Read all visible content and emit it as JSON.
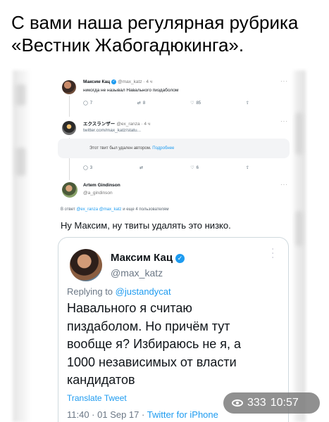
{
  "post": {
    "caption_line1": "С вами наша регулярная рубрика",
    "caption_line2": "«Вестник Жабогадюкинга».",
    "views": "333",
    "time": "10:57"
  },
  "tweet1": {
    "name": "Максим Кац",
    "handle": "@max_katz · 4 ч",
    "text": "никогда не называл Навального пиздаболом",
    "replies": "7",
    "retweets": "8",
    "likes": "85"
  },
  "tweet2": {
    "name": "エクスランザー",
    "handle": "@ex_ranza · 4 ч",
    "link": "twitter.com/max_katz/statu...",
    "deleted_text": "Этот твит был удален автором.",
    "deleted_more": "Подробнее",
    "replies": "3",
    "likes": "6"
  },
  "tweet3": {
    "name": "Artem Gindinson",
    "handle": "@a_gindinson",
    "reply_prefix": "В ответ",
    "reply_mentions": "@ex_ranza @max_katz",
    "reply_suffix": "и еще 4 пользователям",
    "text": "Ну Максим, ну твиты удалять это низко."
  },
  "quoted": {
    "name": "Максим Кац",
    "handle": "@max_katz",
    "replying_prefix": "Replying to",
    "replying_mention": "@justandycat",
    "lines": [
      "Навального я считаю",
      "пиздаболом. Но причём тут",
      "вообще я? Избираюсь не я, а",
      "1000 независимых от власти",
      "кандидатов"
    ],
    "translate": "Translate Tweet",
    "meta_time": "11:40 · 01 Sep 17 · ",
    "meta_source": "Twitter for iPhone"
  },
  "colors": {
    "accent": "#1d9bf0",
    "muted": "#536471"
  }
}
